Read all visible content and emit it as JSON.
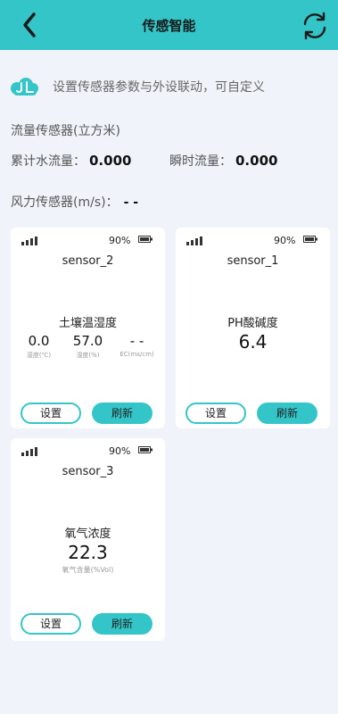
{
  "header": {
    "title": "传感智能",
    "back_icon": "chevron-left-icon",
    "refresh_icon": "refresh-icon"
  },
  "intro": {
    "text": "设置传感器参数与外设联动，可自定义"
  },
  "flow": {
    "title": "流量传感器(立方米)",
    "cumulative_label": "累计水流量：",
    "cumulative_value": "0.000",
    "instant_label": "瞬时流量：",
    "instant_value": "0.000"
  },
  "wind": {
    "label": "风力传感器(m/s)：",
    "value": "- -"
  },
  "cards": [
    {
      "battery": "90%",
      "name": "sensor_2",
      "type": "土壤温湿度",
      "readings": [
        {
          "value": "0.0",
          "label": "湿度(℃)"
        },
        {
          "value": "57.0",
          "label": "湿度(%)"
        },
        {
          "value": "- -",
          "label": "EC(ms/cm)"
        }
      ],
      "set_label": "设置",
      "refresh_label": "刷新"
    },
    {
      "battery": "90%",
      "name": "sensor_1",
      "type": "PH酸碱度",
      "value": "6.4",
      "set_label": "设置",
      "refresh_label": "刷新"
    },
    {
      "battery": "90%",
      "name": "sensor_3",
      "type": "氧气浓度",
      "value": "22.3",
      "sub": "氧气含量(%Vol)",
      "set_label": "设置",
      "refresh_label": "刷新"
    }
  ],
  "colors": {
    "accent": "#33c5c8",
    "background": "#f0f4fa"
  }
}
